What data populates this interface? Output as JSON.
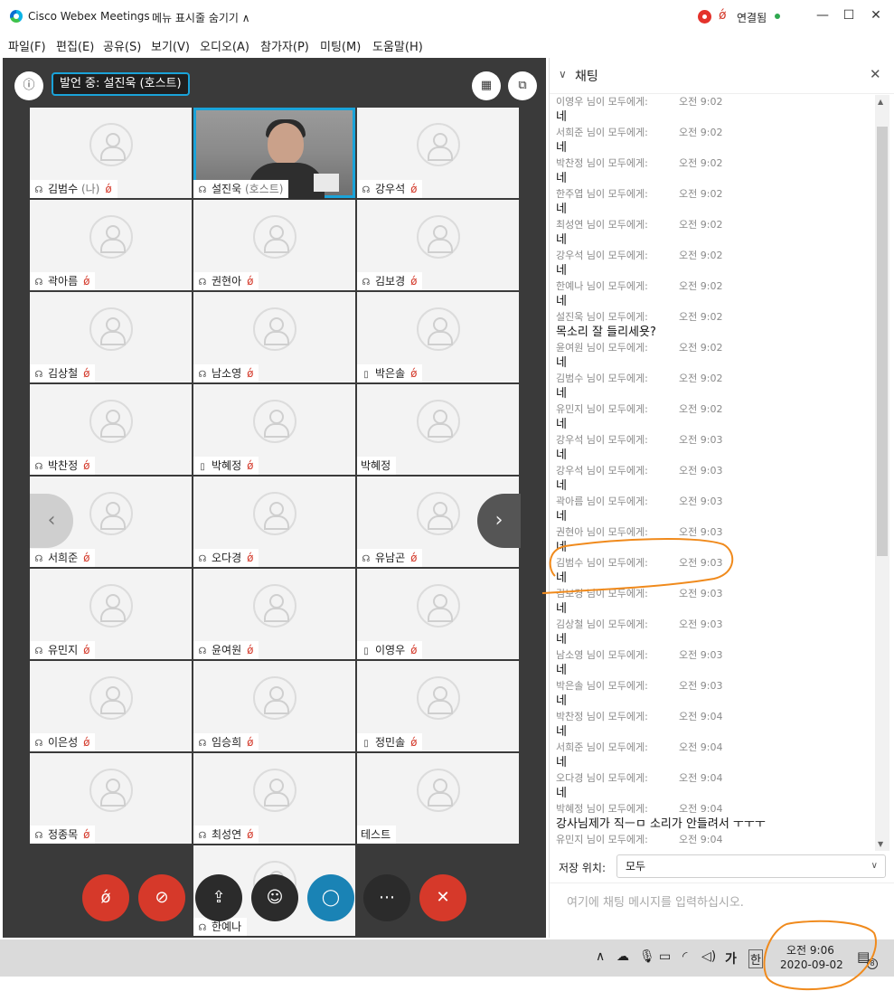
{
  "window": {
    "app_title": "Cisco Webex Meetings",
    "menu_toggle": "메뉴 표시줄 숨기기 ∧",
    "status": "연결됨"
  },
  "menu": [
    "파일(F)",
    "편집(E)",
    "공유(S)",
    "보기(V)",
    "오디오(A)",
    "참가자(P)",
    "미팅(M)",
    "도움말(H)"
  ],
  "stage": {
    "speaker": "발언 중: 설진욱 (호스트)",
    "participants": [
      {
        "name": "김범수",
        "role": "(나)",
        "icon": "headset",
        "muted": true
      },
      {
        "name": "설진욱",
        "role": "(호스트)",
        "icon": "headset",
        "muted": false,
        "active": true
      },
      {
        "name": "강우석",
        "icon": "headset",
        "muted": true
      },
      {
        "name": "곽아름",
        "icon": "headset",
        "muted": true
      },
      {
        "name": "권현아",
        "icon": "headset",
        "muted": true
      },
      {
        "name": "김보경",
        "icon": "headset",
        "muted": true
      },
      {
        "name": "김상철",
        "icon": "headset",
        "muted": true
      },
      {
        "name": "남소영",
        "icon": "headset",
        "muted": true
      },
      {
        "name": "박은솔",
        "icon": "phone",
        "muted": true
      },
      {
        "name": "박찬정",
        "icon": "headset",
        "muted": true
      },
      {
        "name": "박혜정",
        "icon": "phone",
        "muted": true
      },
      {
        "name": "박혜정",
        "icon": "none",
        "muted": false
      },
      {
        "name": "서희준",
        "icon": "headset",
        "muted": true
      },
      {
        "name": "오다경",
        "icon": "headset",
        "muted": true
      },
      {
        "name": "유남곤",
        "icon": "headset",
        "muted": true
      },
      {
        "name": "유민지",
        "icon": "headset",
        "muted": true
      },
      {
        "name": "윤여원",
        "icon": "headset",
        "muted": true
      },
      {
        "name": "이영우",
        "icon": "phone",
        "muted": true
      },
      {
        "name": "이은성",
        "icon": "headset",
        "muted": true
      },
      {
        "name": "임승희",
        "icon": "headset",
        "muted": true
      },
      {
        "name": "정민솔",
        "icon": "phone",
        "muted": true
      },
      {
        "name": "정종목",
        "icon": "headset",
        "muted": true
      },
      {
        "name": "최성연",
        "icon": "headset",
        "muted": true
      },
      {
        "name": "테스트",
        "icon": "none",
        "muted": false
      },
      {
        "name": "한예나",
        "icon": "headset",
        "muted": false
      }
    ]
  },
  "chat": {
    "title": "채팅",
    "messages": [
      {
        "from": "이영우 님이 모두에게:",
        "time": "오전 9:02",
        "text": "네"
      },
      {
        "from": "서희준 님이 모두에게:",
        "time": "오전 9:02",
        "text": "네"
      },
      {
        "from": "박찬정 님이 모두에게:",
        "time": "오전 9:02",
        "text": "네"
      },
      {
        "from": "한주엽 님이 모두에게:",
        "time": "오전 9:02",
        "text": "네"
      },
      {
        "from": "최성연 님이 모두에게:",
        "time": "오전 9:02",
        "text": "네"
      },
      {
        "from": "강우석 님이 모두에게:",
        "time": "오전 9:02",
        "text": "네"
      },
      {
        "from": "한예나 님이 모두에게:",
        "time": "오전 9:02",
        "text": "네"
      },
      {
        "from": "설진욱 님이 모두에게:",
        "time": "오전 9:02",
        "text": "목소리 잘 들리세욧?"
      },
      {
        "from": "윤여원 님이 모두에게:",
        "time": "오전 9:02",
        "text": "네"
      },
      {
        "from": "김범수 님이 모두에게:",
        "time": "오전 9:02",
        "text": "네"
      },
      {
        "from": "유민지 님이 모두에게:",
        "time": "오전 9:02",
        "text": "네"
      },
      {
        "from": "강우석 님이 모두에게:",
        "time": "오전 9:03",
        "text": "네"
      },
      {
        "from": "강우석 님이 모두에게:",
        "time": "오전 9:03",
        "text": "네"
      },
      {
        "from": "곽아름 님이 모두에게:",
        "time": "오전 9:03",
        "text": "네"
      },
      {
        "from": "권현아 님이 모두에게:",
        "time": "오전 9:03",
        "text": "네"
      },
      {
        "from": "김범수 님이 모두에게:",
        "time": "오전 9:03",
        "text": "네"
      },
      {
        "from": "김보경 님이 모두에게:",
        "time": "오전 9:03",
        "text": "네"
      },
      {
        "from": "김상철 님이 모두에게:",
        "time": "오전 9:03",
        "text": "네"
      },
      {
        "from": "남소영 님이 모두에게:",
        "time": "오전 9:03",
        "text": "네"
      },
      {
        "from": "박은솔 님이 모두에게:",
        "time": "오전 9:03",
        "text": "네"
      },
      {
        "from": "박찬정 님이 모두에게:",
        "time": "오전 9:04",
        "text": "네"
      },
      {
        "from": "서희준 님이 모두에게:",
        "time": "오전 9:04",
        "text": "네"
      },
      {
        "from": "오다경 님이 모두에게:",
        "time": "오전 9:04",
        "text": "네"
      },
      {
        "from": "박혜정 님이 모두에게:",
        "time": "오전 9:04",
        "text": "강사님제가 직ㅡㅁ 소리가 안들려서 ㅜㅜㅜ"
      },
      {
        "from": "유민지 님이 모두에게:",
        "time": "오전 9:04",
        "text": ""
      }
    ],
    "save_label": "저장 위치:",
    "save_value": "모두",
    "input_placeholder": "여기에 채팅 메시지를 입력하십시오."
  },
  "taskbar": {
    "ime": "가",
    "ime2": "한",
    "time": "오전 9:06",
    "date": "2020-09-02",
    "notif_count": "8"
  },
  "colors": {
    "accent": "#1aa3d9",
    "mute": "#d43a2b",
    "annotation": "#f08a1c"
  }
}
